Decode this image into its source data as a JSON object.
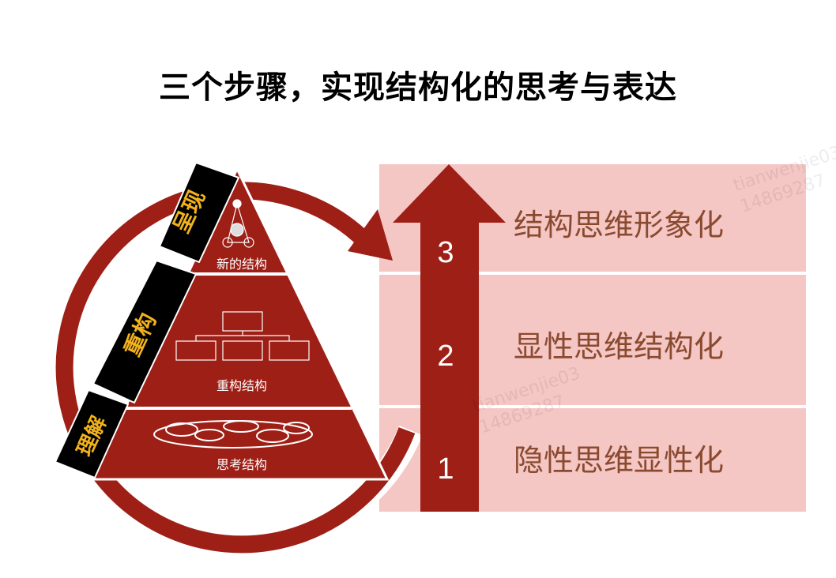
{
  "title": "三个步骤，实现结构化的思考与表达",
  "colors": {
    "dark_red": "#9e1f16",
    "pink": "#f4c6c4",
    "tab_black": "#000000",
    "tab_text": "#f3b21c",
    "step_text": "#8a4a2f"
  },
  "steps": [
    {
      "number": "3",
      "label": "结构思维形象化"
    },
    {
      "number": "2",
      "label": "显性思维结构化"
    },
    {
      "number": "1",
      "label": "隐性思维显性化"
    }
  ],
  "pyramid": {
    "levels": [
      {
        "label": "新的结构",
        "icon": "network-nodes-icon"
      },
      {
        "label": "重构结构",
        "icon": "hierarchy-chart-icon"
      },
      {
        "label": "思考结构",
        "icon": "scribble-cluster-icon"
      }
    ],
    "tabs": [
      "呈现",
      "重构",
      "理解"
    ]
  },
  "watermark": {
    "line1": "tianwenjie03",
    "line2": "14869287"
  }
}
